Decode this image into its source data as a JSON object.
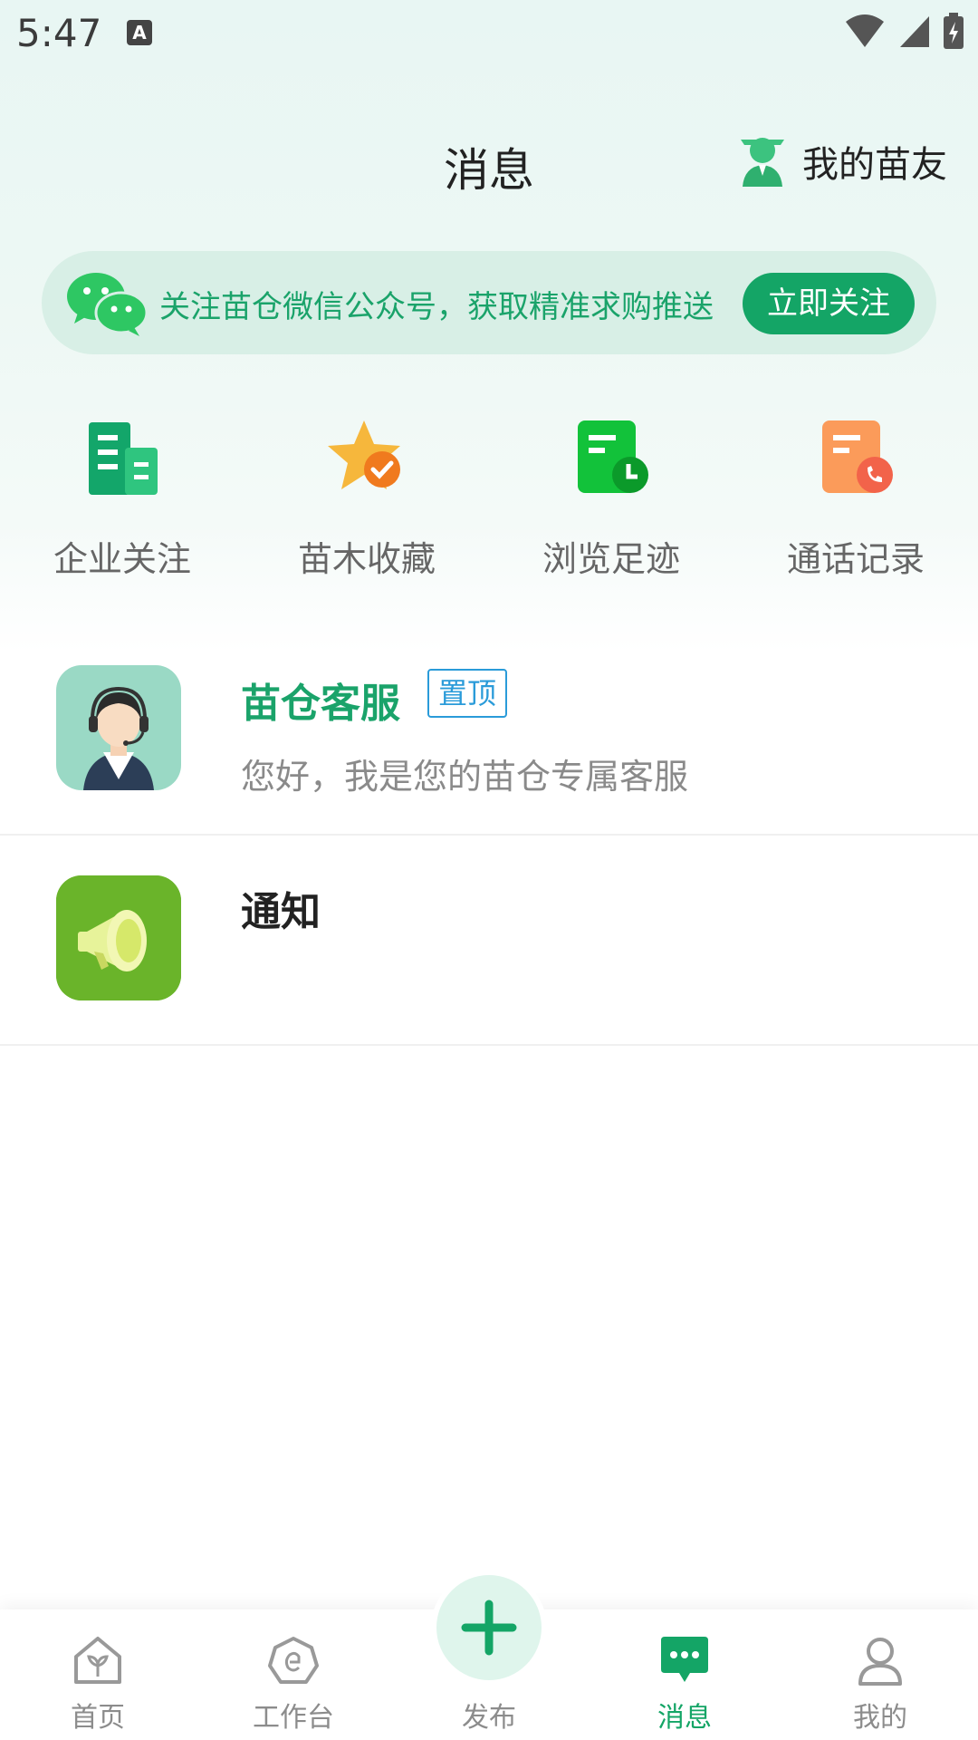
{
  "status_bar": {
    "time": "5:47",
    "notification_badge": "A"
  },
  "header": {
    "title": "消息",
    "friends_label": "我的苗友"
  },
  "banner": {
    "text": "关注苗仓微信公众号，获取精准求购推送",
    "button_label": "立即关注"
  },
  "quick_actions": [
    {
      "label": "企业关注",
      "icon": "building-icon"
    },
    {
      "label": "苗木收藏",
      "icon": "star-check-icon"
    },
    {
      "label": "浏览足迹",
      "icon": "history-doc-icon"
    },
    {
      "label": "通话记录",
      "icon": "call-record-icon"
    }
  ],
  "messages": [
    {
      "title": "苗仓客服",
      "badge": "置顶",
      "subtitle": "您好，我是您的苗仓专属客服",
      "icon": "customer-service-avatar"
    },
    {
      "title": "通知",
      "subtitle": "",
      "icon": "megaphone-icon"
    }
  ],
  "tabbar": {
    "items": [
      {
        "label": "首页",
        "icon": "home-plant-icon"
      },
      {
        "label": "工作台",
        "icon": "workbench-icon"
      },
      {
        "label": "发布",
        "icon": "plus-icon"
      },
      {
        "label": "消息",
        "icon": "chat-bubble-icon",
        "active": true
      },
      {
        "label": "我的",
        "icon": "user-icon"
      }
    ]
  },
  "colors": {
    "primary": "#14a566",
    "banner_bg": "#d8efe6",
    "pin_badge": "#2a9bd9",
    "inactive": "#8c8c8c"
  }
}
